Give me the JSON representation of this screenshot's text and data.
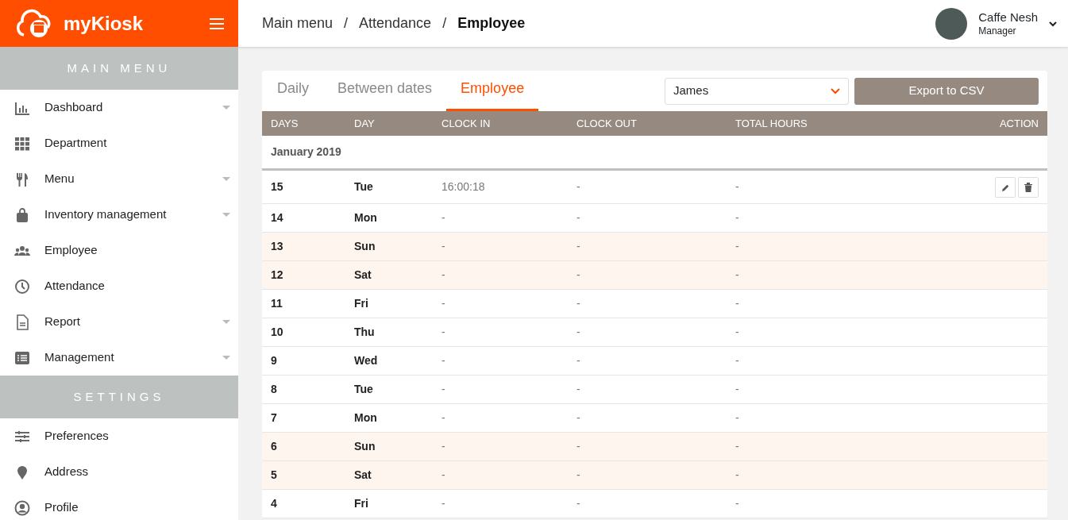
{
  "brand": {
    "name": "myKiosk"
  },
  "sidebar": {
    "sections": [
      {
        "title": "MAIN MENU",
        "items": [
          {
            "label": "Dashboard",
            "has_submenu": true
          },
          {
            "label": "Department",
            "has_submenu": false
          },
          {
            "label": "Menu",
            "has_submenu": true
          },
          {
            "label": "Inventory management",
            "has_submenu": true
          },
          {
            "label": "Employee",
            "has_submenu": false
          },
          {
            "label": "Attendance",
            "has_submenu": false
          },
          {
            "label": "Report",
            "has_submenu": true
          },
          {
            "label": "Management",
            "has_submenu": true
          }
        ]
      },
      {
        "title": "SETTINGS",
        "items": [
          {
            "label": "Preferences",
            "has_submenu": false
          },
          {
            "label": "Address",
            "has_submenu": false
          },
          {
            "label": "Profile",
            "has_submenu": false
          }
        ]
      }
    ]
  },
  "breadcrumb": [
    {
      "kind": "link",
      "text": "Main menu"
    },
    {
      "kind": "separator",
      "text": "/"
    },
    {
      "kind": "link",
      "text": "Attendance"
    },
    {
      "kind": "separator",
      "text": "/"
    },
    {
      "kind": "current",
      "text": "Employee"
    }
  ],
  "user": {
    "name": "Caffe Nesh",
    "role": "Manager"
  },
  "tabs": [
    {
      "label": "Daily",
      "selected": false
    },
    {
      "label": "Between dates",
      "selected": false
    },
    {
      "label": "Employee",
      "selected": true
    }
  ],
  "employee_select": {
    "value": "James"
  },
  "export_button": "Export to CSV",
  "table": {
    "columns": [
      "DAYS",
      "DAY",
      "CLOCK IN",
      "CLOCK OUT",
      "TOTAL HOURS",
      "ACTION"
    ],
    "group": "January 2019",
    "rows": [
      {
        "days": "15",
        "day": "Tue",
        "clock_in": "16:00:18",
        "clock_out": "-",
        "total_hours": "-",
        "weekend": false,
        "has_actions": true
      },
      {
        "days": "14",
        "day": "Mon",
        "clock_in": "-",
        "clock_out": "-",
        "total_hours": "-",
        "weekend": false,
        "has_actions": false
      },
      {
        "days": "13",
        "day": "Sun",
        "clock_in": "-",
        "clock_out": "-",
        "total_hours": "-",
        "weekend": true,
        "has_actions": false
      },
      {
        "days": "12",
        "day": "Sat",
        "clock_in": "-",
        "clock_out": "-",
        "total_hours": "-",
        "weekend": true,
        "has_actions": false
      },
      {
        "days": "11",
        "day": "Fri",
        "clock_in": "-",
        "clock_out": "-",
        "total_hours": "-",
        "weekend": false,
        "has_actions": false
      },
      {
        "days": "10",
        "day": "Thu",
        "clock_in": "-",
        "clock_out": "-",
        "total_hours": "-",
        "weekend": false,
        "has_actions": false
      },
      {
        "days": "9",
        "day": "Wed",
        "clock_in": "-",
        "clock_out": "-",
        "total_hours": "-",
        "weekend": false,
        "has_actions": false
      },
      {
        "days": "8",
        "day": "Tue",
        "clock_in": "-",
        "clock_out": "-",
        "total_hours": "-",
        "weekend": false,
        "has_actions": false
      },
      {
        "days": "7",
        "day": "Mon",
        "clock_in": "-",
        "clock_out": "-",
        "total_hours": "-",
        "weekend": false,
        "has_actions": false
      },
      {
        "days": "6",
        "day": "Sun",
        "clock_in": "-",
        "clock_out": "-",
        "total_hours": "-",
        "weekend": true,
        "has_actions": false
      },
      {
        "days": "5",
        "day": "Sat",
        "clock_in": "-",
        "clock_out": "-",
        "total_hours": "-",
        "weekend": true,
        "has_actions": false
      },
      {
        "days": "4",
        "day": "Fri",
        "clock_in": "-",
        "clock_out": "-",
        "total_hours": "-",
        "weekend": false,
        "has_actions": false
      }
    ]
  }
}
